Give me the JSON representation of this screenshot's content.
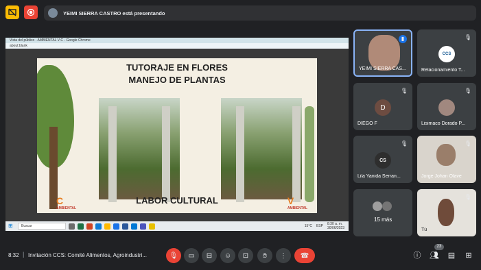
{
  "top_bar": {
    "presenting_text": "YEIMI SIERRA CASTRO está presentando"
  },
  "presentation": {
    "window_title": "Vista del público - AMBIENTAL V-C - Google Chrome",
    "url": "about:blank",
    "slide": {
      "title_line1": "TUTORAJE EN FLORES",
      "title_line2": "MANEJO DE PLANTAS",
      "footer": "LABOR CULTURAL",
      "logo_left": "AMBIENTAL",
      "logo_right": "AMBIENTAL"
    },
    "taskbar": {
      "search": "Buscar",
      "temp": "15°C",
      "lang": "ESP",
      "clock_time": "8:30 a. m.",
      "clock_date": "30/06/2023"
    }
  },
  "participants": [
    {
      "name": "YEIMI SIERRA CAS...",
      "avatar": "",
      "color": "#8d6e63"
    },
    {
      "name": "Relacionamiento T...",
      "avatar": "CCS",
      "color": "#ffffff"
    },
    {
      "name": "DIEGO F",
      "avatar": "D",
      "color": "#6d4c41"
    },
    {
      "name": "Lisimaco Dorado P...",
      "avatar": "",
      "color": "#a1887f"
    },
    {
      "name": "Lila Yanida Serran...",
      "avatar": "CS",
      "color": "#2e2e2e"
    },
    {
      "name": "Jorge Johan Olave",
      "avatar": "",
      "color": "#b0a79a"
    },
    {
      "name": "15 más",
      "avatar": "",
      "color": "#8d8d8d"
    },
    {
      "name": "Tú",
      "avatar": "",
      "color": "#c9b8a8"
    }
  ],
  "bottom_bar": {
    "time": "8:32",
    "separator": "|",
    "meeting_title": "Invitación CCS: Comité Alimentos, Agroindustri...",
    "participant_count": "23"
  },
  "colors": {
    "background": "#202124",
    "tile": "#3c4043",
    "danger": "#ea4335",
    "warning": "#fbbc04",
    "accent": "#8ab4f8"
  }
}
